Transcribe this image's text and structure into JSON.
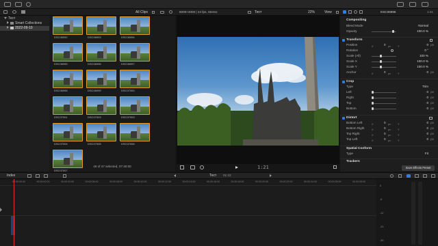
{
  "library": {
    "items": [
      {
        "label": "Тест",
        "expanded": true
      },
      {
        "label": "Smart Collections",
        "expanded": false
      },
      {
        "label": "2022-09-10",
        "expanded": false,
        "selected": true
      }
    ]
  },
  "browser": {
    "filter": "All Clips",
    "clips": [
      "DSC06992",
      "DSC06993",
      "DSC06994",
      "DSC06995",
      "DSC06996",
      "DSC06997",
      "DSC06998",
      "DSC06999",
      "DSC07000",
      "DSC07001",
      "DSC07003",
      "DSC07003",
      "DSC07004",
      "DSC07005",
      "DSC07006",
      "DSC07007"
    ],
    "status": "46 of 47 selected, 07:40:00"
  },
  "viewer": {
    "format": "6000×4000 | 24 fps, Stereo",
    "title": "Тест",
    "zoom": "22%",
    "view_label": "View",
    "timecode": "1:21"
  },
  "inspector": {
    "title": "DSC06995",
    "duration": "1:21",
    "sections": {
      "compositing": "Compositing",
      "blend_mode_label": "Blend Mode",
      "blend_mode_value": "Normal",
      "opacity_label": "Opacity",
      "opacity_value": "100.0 %",
      "transform": "Transform",
      "position_label": "Position",
      "rotation_label": "Rotation",
      "rotation_value": "0 °",
      "scale_all_label": "Scale (All)",
      "scale_all_value": "100 %",
      "scale_x_label": "Scale X",
      "scale_x_value": "100.0 %",
      "scale_y_label": "Scale Y",
      "scale_y_value": "100.0 %",
      "anchor_label": "Anchor",
      "crop": "Crop",
      "crop_type_label": "Type",
      "crop_type_value": "Trim",
      "left_label": "Left",
      "right_label": "Right",
      "top_label": "Top",
      "bottom_label": "Bottom",
      "distort": "Distort",
      "bl_label": "Bottom Left",
      "br_label": "Bottom Right",
      "tr_label": "Top Right",
      "tl_label": "Top Left",
      "spatial": "Spatial Conform",
      "sc_type_label": "Type",
      "sc_type_value": "Fit",
      "trackers": "Trackers",
      "zero": "0",
      "px": "px",
      "x": "X",
      "y": "Y"
    },
    "save_preset": "Save Effects Preset"
  },
  "timeline": {
    "index_label": "Index",
    "project_title": "Тест",
    "project_duration": "01:22",
    "ruler_ticks": [
      "00:00:00:00",
      "00:00:02:00",
      "00:00:04:00",
      "00:00:06:00",
      "00:00:08:00",
      "00:00:10:00",
      "00:00:12:00",
      "00:00:14:00",
      "00:00:16:00",
      "00:00:18:00",
      "00:00:20:00",
      "00:00:22:00",
      "00:00:24:00",
      "00:00:26:00",
      "00:00:28:00"
    ],
    "meter_labels": [
      "0",
      "-6",
      "-12",
      "-20",
      "-30"
    ]
  },
  "colors": {
    "accent": "#2f7be8",
    "clip_border": "#e49a2d",
    "playhead": "#e03030"
  }
}
